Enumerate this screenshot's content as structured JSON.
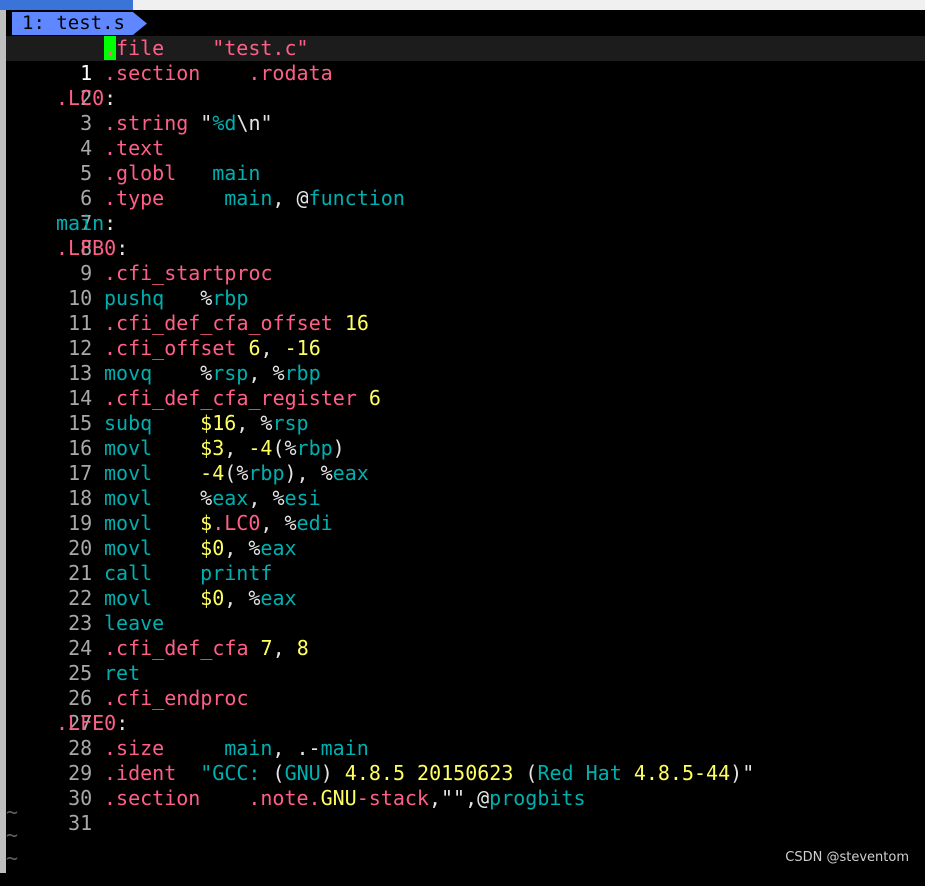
{
  "tab": {
    "label": "1: test.s"
  },
  "lines": [
    {
      "n": "1"
    },
    {
      "n": "2"
    },
    {
      "n": "3"
    },
    {
      "n": "4"
    },
    {
      "n": "5"
    },
    {
      "n": "6"
    },
    {
      "n": "7"
    },
    {
      "n": "8"
    },
    {
      "n": "9"
    },
    {
      "n": "10"
    },
    {
      "n": "11"
    },
    {
      "n": "12"
    },
    {
      "n": "13"
    },
    {
      "n": "14"
    },
    {
      "n": "15"
    },
    {
      "n": "16"
    },
    {
      "n": "17"
    },
    {
      "n": "18"
    },
    {
      "n": "19"
    },
    {
      "n": "20"
    },
    {
      "n": "21"
    },
    {
      "n": "22"
    },
    {
      "n": "23"
    },
    {
      "n": "24"
    },
    {
      "n": "25"
    },
    {
      "n": "26"
    },
    {
      "n": "27"
    },
    {
      "n": "28"
    },
    {
      "n": "29"
    },
    {
      "n": "30"
    },
    {
      "n": "31"
    }
  ],
  "code": {
    "l1": {
      "cursor": ".",
      "dir": "file",
      "arg": "\"test.c\""
    },
    "l2": {
      "dir": ".section",
      "arg": ".rodata"
    },
    "l3": {
      "label": ".LC0",
      "colon": ":"
    },
    "l4": {
      "dir": ".string",
      "q1": "\"",
      "fmt": "%d",
      "esc": "\\n",
      "q2": "\""
    },
    "l5": {
      "dir": ".text"
    },
    "l6": {
      "dir": ".globl",
      "arg": "main"
    },
    "l7": {
      "dir": ".type",
      "arg": "main",
      "comma": ",",
      "at": "@",
      "fn": "function"
    },
    "l8": {
      "label": "main",
      "colon": ":"
    },
    "l9": {
      "label": ".LFB0",
      "colon": ":"
    },
    "l10": {
      "dir": ".cfi_startproc"
    },
    "l11": {
      "ins": "pushq",
      "pct": "%",
      "reg": "rbp"
    },
    "l12": {
      "dir": ".cfi_def_cfa_offset",
      "num": "16"
    },
    "l13": {
      "dir": ".cfi_offset",
      "num1": "6",
      "comma": ",",
      "num2": "-16"
    },
    "l14": {
      "ins": "movq",
      "pct1": "%",
      "reg1": "rsp",
      "comma": ",",
      "pct2": "%",
      "reg2": "rbp"
    },
    "l15": {
      "dir": ".cfi_def_cfa_register",
      "num": "6"
    },
    "l16": {
      "ins": "subq",
      "imm": "$16",
      "comma": ",",
      "pct": "%",
      "reg": "rsp"
    },
    "l17": {
      "ins": "movl",
      "imm": "$3",
      "comma": ",",
      "off": "-4",
      "lp": "(",
      "pct": "%",
      "reg": "rbp",
      "rp": ")"
    },
    "l18": {
      "ins": "movl",
      "off": "-4",
      "lp": "(",
      "pct1": "%",
      "reg1": "rbp",
      "rp": ")",
      "comma": ",",
      "pct2": "%",
      "reg2": "eax"
    },
    "l19": {
      "ins": "movl",
      "pct1": "%",
      "reg1": "eax",
      "comma": ",",
      "pct2": "%",
      "reg2": "esi"
    },
    "l20": {
      "ins": "movl",
      "dollar": "$",
      "sym": ".LC0",
      "comma": ",",
      "pct": "%",
      "reg": "edi"
    },
    "l21": {
      "ins": "movl",
      "imm": "$0",
      "comma": ",",
      "pct": "%",
      "reg": "eax"
    },
    "l22": {
      "ins": "call",
      "sym": "printf"
    },
    "l23": {
      "ins": "movl",
      "imm": "$0",
      "comma": ",",
      "pct": "%",
      "reg": "eax"
    },
    "l24": {
      "ins": "leave"
    },
    "l25": {
      "dir": ".cfi_def_cfa",
      "num1": "7",
      "comma": ",",
      "num2": "8"
    },
    "l26": {
      "ins": "ret"
    },
    "l27": {
      "dir": ".cfi_endproc"
    },
    "l28": {
      "label": ".LFE0",
      "colon": ":"
    },
    "l29": {
      "dir": ".size",
      "arg": "main",
      "comma": ",",
      "dot": ".",
      "minus": "-",
      "arg2": "main"
    },
    "l30": {
      "dir": ".ident",
      "q1": "\"GCC:",
      "lp1": "(",
      "gnu": "GNU",
      "rp1": ")",
      "ver1": "4.8.5",
      "date": "20150623",
      "lp2": "(",
      "rh": "Red Hat",
      "ver2": "4.8.5-44",
      "rp2": ")",
      "q2": "\""
    },
    "l31": {
      "dir": ".section",
      "sec": ".note.",
      "gnu": "GNU",
      "stack": "-stack",
      "rest": ",\"\",",
      "at": "@",
      "pb": "progbits"
    }
  },
  "tildes": [
    "~",
    "~",
    "~"
  ],
  "watermark": "CSDN @steventom",
  "colors": {
    "background": "#000000",
    "tab": "#5f87ff",
    "keyword": "#ff5f87",
    "identifier": "#00afaf",
    "number": "#ffff5f",
    "cursor": "#00ff00",
    "line_number": "#a8a8a8"
  }
}
